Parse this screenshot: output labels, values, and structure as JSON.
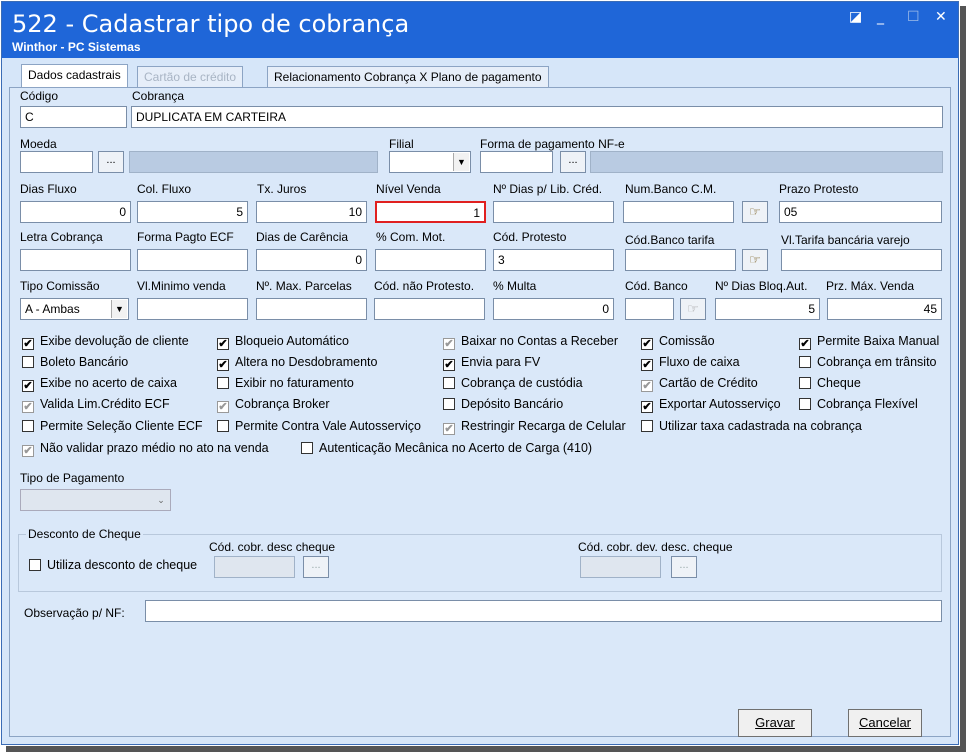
{
  "window": {
    "title": "522 - Cadastrar tipo de cobrança",
    "subtitle": "Winthor - PC Sistemas"
  },
  "tabs": [
    "Dados cadastrais",
    "Cartão de crédito",
    "Relacionamento Cobrança X Plano de pagamento"
  ],
  "labels": {
    "codigo": "Código",
    "cobranca": "Cobrança",
    "moeda": "Moeda",
    "filial": "Filial",
    "forma_pag": "Forma de pagamento NF-e",
    "dias_fluxo": "Dias Fluxo",
    "col_fluxo": "Col. Fluxo",
    "tx_juros": "Tx. Juros",
    "nivel_venda": "Nível Venda",
    "dias_lib": "Nº Dias p/ Lib. Créd.",
    "num_banco": "Num.Banco C.M.",
    "prazo_protesto": "Prazo Protesto",
    "letra": "Letra Cobrança",
    "forma_ecf": "Forma Pagto ECF",
    "dias_carencia": "Dias de Carência",
    "com_mot": "% Com. Mot.",
    "cod_protesto": "Cód. Protesto",
    "cod_banco_tarifa": "Cód.Banco tarifa",
    "vl_tarifa": "Vl.Tarifa bancária varejo",
    "tipo_comissao": "Tipo Comissão",
    "vl_minimo": "Vl.Minimo venda",
    "max_parcelas": "Nº. Max. Parcelas",
    "cod_nao_protesto": "Cód. não Protesto.",
    "multa": "% Multa",
    "cod_banco": "Cód. Banco",
    "dias_bloq": "Nº Dias Bloq.Aut.",
    "prz_max": "Prz. Máx. Venda",
    "tipo_pag": "Tipo de Pagamento",
    "desc_cheque": "Desconto de Cheque",
    "utiliza_desc": "Utiliza desconto de cheque",
    "cod_desc": "Cód. cobr. desc cheque",
    "cod_dev": "Cód. cobr. dev. desc. cheque",
    "obs": "Observação p/ NF:"
  },
  "values": {
    "codigo": "C",
    "cobranca": "DUPLICATA EM CARTEIRA",
    "dias_fluxo": "0",
    "col_fluxo": "5",
    "tx_juros": "10",
    "nivel_venda": "1",
    "prazo_protesto": "05",
    "dias_carencia": "0",
    "cod_protesto": "3",
    "tipo_comissao": "A - Ambas",
    "multa": "0",
    "dias_bloq": "5",
    "prz_max": "45",
    "ellipsis": "..."
  },
  "checkboxes": [
    [
      "Exibe devolução de cliente",
      "Bloqueio Automático",
      "Baixar no Contas a Receber",
      "Comissão",
      "Permite Baixa Manual"
    ],
    [
      "Boleto Bancário",
      "Altera no Desdobramento",
      "Envia para FV",
      "Fluxo de caixa",
      "Cobrança em trânsito"
    ],
    [
      "Exibe no acerto de caixa",
      "Exibir no faturamento",
      "Cobrança de custódia",
      "Cartão de Crédito",
      "Cheque"
    ],
    [
      "Valida Lim.Crédito ECF",
      "Cobrança Broker",
      "Depósito Bancário",
      "Exportar Autosserviço",
      "Cobrança Flexível"
    ],
    [
      "Permite Seleção Cliente ECF",
      "Permite Contra Vale Autosserviço",
      "Restringir Recarga de Celular",
      "Utilizar taxa cadastrada na cobrança"
    ],
    [
      "Não validar prazo médio no ato na venda",
      "Autenticação Mecânica no Acerto de Carga (410)"
    ]
  ],
  "buttons": {
    "gravar": "Gravar",
    "cancelar": "Cancelar"
  }
}
